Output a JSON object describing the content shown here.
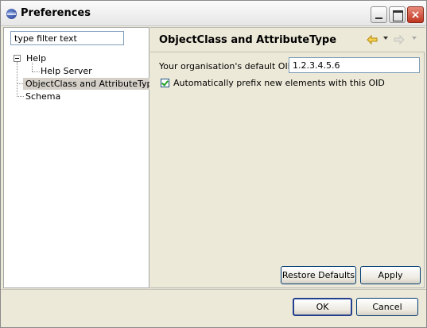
{
  "window": {
    "title": "Preferences"
  },
  "title_buttons": {
    "close_glyph": "×"
  },
  "filter": {
    "value": "type filter text"
  },
  "tree": {
    "items": [
      {
        "label": "Help"
      },
      {
        "label": "Help Server"
      },
      {
        "label": "ObjectClass and AttributeType"
      },
      {
        "label": "Schema"
      }
    ]
  },
  "page": {
    "title": "ObjectClass and AttributeType",
    "oid_label": "Your organisation's default OID:",
    "oid_value": "1.2.3.4.5.6",
    "prefix_label": "Automatically prefix new elements with this OID",
    "prefix_checked": true,
    "restore_label": "Restore Defaults",
    "apply_label": "Apply"
  },
  "dialog": {
    "ok_label": "OK",
    "cancel_label": "Cancel"
  },
  "colors": {
    "selection": "#d4d0c8",
    "window_bg": "#ece9d8",
    "nav_arrow": "#f0c030"
  },
  "icons": [
    "app-icon",
    "back-arrow-icon",
    "forward-arrow-icon",
    "minimize-icon",
    "maximize-icon",
    "close-icon",
    "checkmark-icon"
  ]
}
